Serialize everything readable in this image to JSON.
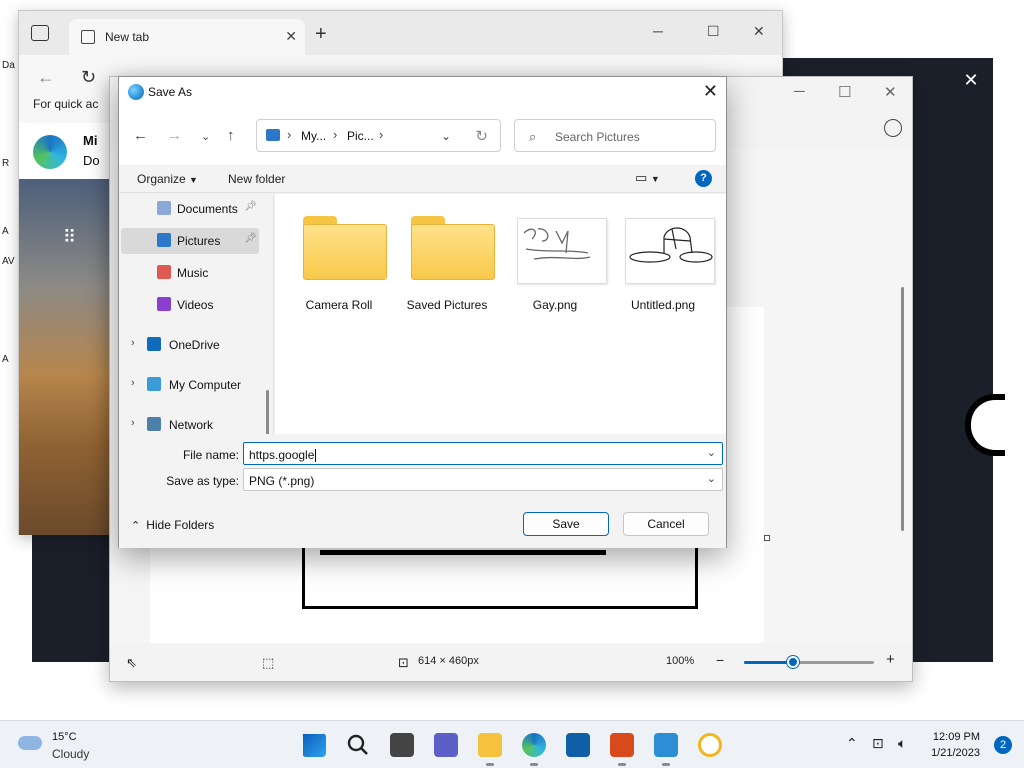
{
  "desktop": {
    "labels": [
      "Da",
      "R",
      "A",
      "AV",
      "A"
    ]
  },
  "edge": {
    "tab_title": "New tab",
    "favorites_text": "For quick ac",
    "ms_title": "Mi",
    "ms_sub": "Do"
  },
  "paint": {
    "canvas_size": "614 × 460px",
    "zoom": "100%",
    "zoom_fraction": 0.38
  },
  "dialog": {
    "title": "Save As",
    "breadcrumb": [
      "My...",
      "Pic..."
    ],
    "search_placeholder": "Search Pictures",
    "toolbar": {
      "organize": "Organize",
      "new_folder": "New folder"
    },
    "sidebar": [
      {
        "label": "Documents",
        "icon": "documents-icon",
        "pinned": true,
        "selected": false,
        "expandable": false,
        "color": "#8aa9d6"
      },
      {
        "label": "Pictures",
        "icon": "pictures-icon",
        "pinned": true,
        "selected": true,
        "expandable": false,
        "color": "#2b78c9"
      },
      {
        "label": "Music",
        "icon": "music-icon",
        "pinned": false,
        "selected": false,
        "expandable": false,
        "color": "#e05a4f"
      },
      {
        "label": "Videos",
        "icon": "videos-icon",
        "pinned": false,
        "selected": false,
        "expandable": false,
        "color": "#8a3fd1"
      },
      {
        "label": "OneDrive",
        "icon": "onedrive-icon",
        "pinned": false,
        "selected": false,
        "expandable": true,
        "color": "#0f6cbd"
      },
      {
        "label": "My Computer",
        "icon": "computer-icon",
        "pinned": false,
        "selected": false,
        "expandable": true,
        "color": "#3a9bd9"
      },
      {
        "label": "Network",
        "icon": "network-icon",
        "pinned": false,
        "selected": false,
        "expandable": true,
        "color": "#4e7fa8"
      }
    ],
    "files": [
      {
        "name": "Camera Roll",
        "kind": "folder"
      },
      {
        "name": "Saved Pictures",
        "kind": "folder"
      },
      {
        "name": "Gay.png",
        "kind": "image"
      },
      {
        "name": "Untitled.png",
        "kind": "image"
      }
    ],
    "file_name_label": "File name:",
    "file_name_value": "https.google",
    "save_type_label": "Save as type:",
    "save_type_value": "PNG (*.png)",
    "hide_folders": "Hide Folders",
    "save_button": "Save",
    "cancel_button": "Cancel"
  },
  "taskbar": {
    "weather_temp": "15°C",
    "weather_condition": "Cloudy",
    "time": "12:09 PM",
    "date": "1/21/2023",
    "notification_count": "2",
    "apps": [
      {
        "name": "start-icon",
        "color": "#0078d4"
      },
      {
        "name": "search-icon",
        "color": "#222222"
      },
      {
        "name": "task-view-icon",
        "color": "#444444"
      },
      {
        "name": "teams-chat-icon",
        "color": "#5b5fc7"
      },
      {
        "name": "file-explorer-icon",
        "color": "#f4c23d"
      },
      {
        "name": "edge-icon",
        "color": "#1b9de2"
      },
      {
        "name": "store-icon",
        "color": "#0f5ea8"
      },
      {
        "name": "office-icon",
        "color": "#d84a1b"
      },
      {
        "name": "paint-icon",
        "color": "#2c8fd6"
      },
      {
        "name": "vpn-icon",
        "color": "#f2b51b"
      }
    ]
  }
}
